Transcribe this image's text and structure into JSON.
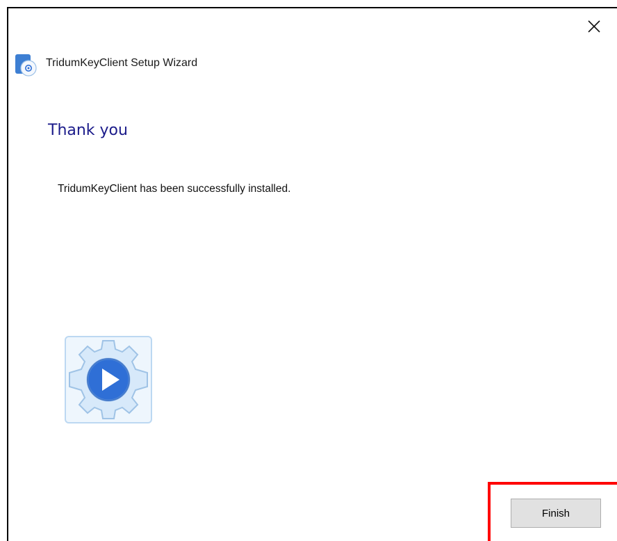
{
  "window": {
    "title": "TridumKeyClient Setup Wizard"
  },
  "page": {
    "heading": "Thank you",
    "message": "TridumKeyClient has been successfully installed."
  },
  "buttons": {
    "finish_label": "Finish",
    "close_icon": "close-icon"
  },
  "icons": {
    "title_icon": "setup-disc-icon",
    "logo": "gear-play-icon"
  },
  "colors": {
    "heading": "#1b1b8a",
    "highlight": "#ff0000",
    "gear_fill": "#d7e9fa",
    "play_circle": "#2f6fd6"
  }
}
